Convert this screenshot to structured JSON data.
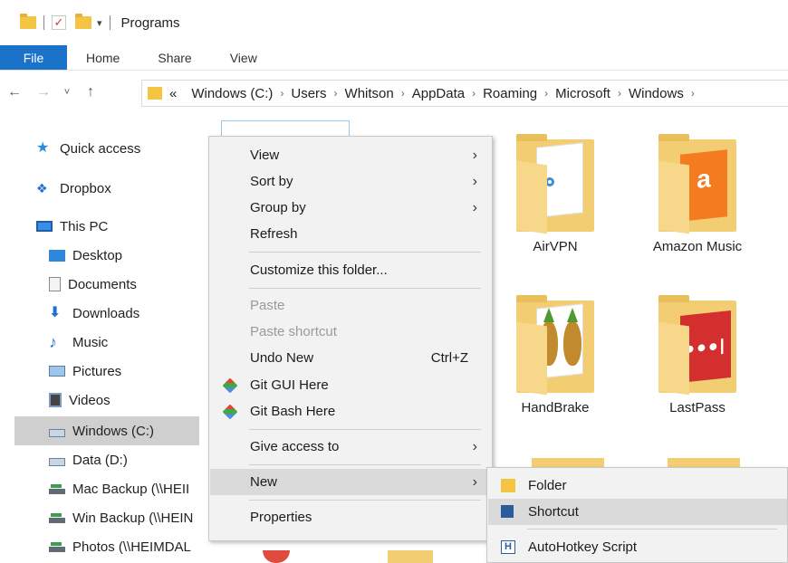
{
  "titlebar": {
    "title": "Programs"
  },
  "ribbon": {
    "tabs": [
      "File",
      "Home",
      "Share",
      "View"
    ]
  },
  "address_bar": {
    "overflow": "«",
    "crumbs": [
      "Windows (C:)",
      "Users",
      "Whitson",
      "AppData",
      "Roaming",
      "Microsoft",
      "Windows"
    ]
  },
  "sidebar": {
    "items": [
      {
        "label": "Quick access",
        "icon": "star-icon"
      },
      {
        "label": "Dropbox",
        "icon": "dropbox-icon"
      },
      {
        "label": "This PC",
        "icon": "computer-icon"
      },
      {
        "label": "Desktop",
        "icon": "desktop-icon"
      },
      {
        "label": "Documents",
        "icon": "documents-icon"
      },
      {
        "label": "Downloads",
        "icon": "download-arrow-icon"
      },
      {
        "label": "Music",
        "icon": "music-note-icon"
      },
      {
        "label": "Pictures",
        "icon": "pictures-icon"
      },
      {
        "label": "Videos",
        "icon": "videos-icon"
      },
      {
        "label": "Windows (C:)",
        "icon": "windows-drive-icon",
        "selected": true
      },
      {
        "label": "Data (D:)",
        "icon": "drive-icon"
      },
      {
        "label": "Mac Backup (\\\\HEII",
        "icon": "network-drive-icon"
      },
      {
        "label": "Win Backup (\\\\HEIN",
        "icon": "network-drive-icon"
      },
      {
        "label": "Photos (\\\\HEIMDAL",
        "icon": "network-drive-icon"
      }
    ]
  },
  "folders": [
    {
      "label": "AirVPN"
    },
    {
      "label": "Amazon Music"
    },
    {
      "label": "HandBrake"
    },
    {
      "label": "LastPass"
    }
  ],
  "folder_art": {
    "amazon_letter": "a",
    "lastpass_mark": "●●●|"
  },
  "context_menu": {
    "items": [
      {
        "label": "View",
        "submenu": true
      },
      {
        "label": "Sort by",
        "submenu": true
      },
      {
        "label": "Group by",
        "submenu": true
      },
      {
        "label": "Refresh"
      },
      {
        "label": "Customize this folder..."
      },
      {
        "label": "Paste",
        "disabled": true
      },
      {
        "label": "Paste shortcut",
        "disabled": true
      },
      {
        "label": "Undo New",
        "shortcut": "Ctrl+Z"
      },
      {
        "label": "Git GUI Here",
        "icon": "git-icon"
      },
      {
        "label": "Git Bash Here",
        "icon": "git-icon"
      },
      {
        "label": "Give access to",
        "submenu": true
      },
      {
        "label": "New",
        "submenu": true,
        "highlighted": true
      },
      {
        "label": "Properties"
      }
    ]
  },
  "new_submenu": {
    "items": [
      {
        "label": "Folder",
        "icon": "folder-icon"
      },
      {
        "label": "Shortcut",
        "icon": "shortcut-icon",
        "highlighted": true
      },
      {
        "label": "AutoHotkey Script",
        "icon": "autohotkey-icon",
        "icon_letter": "H"
      }
    ]
  },
  "colors": {
    "file_tab": "#1a73c8",
    "menu_background": "#f2f2f2",
    "menu_highlight": "#dadada",
    "sidebar_selected": "#cfcfcf",
    "folder": "#f2cd72"
  }
}
